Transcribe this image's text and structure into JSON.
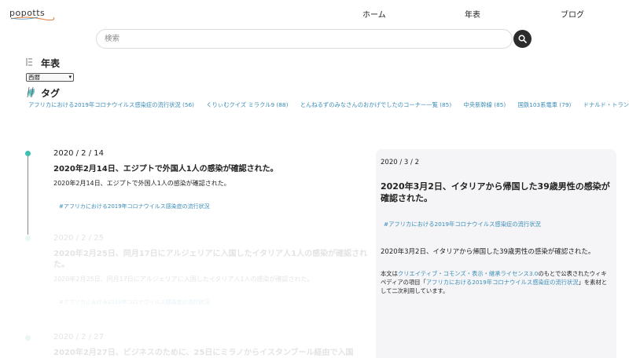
{
  "header": {
    "logo_text": "popotts",
    "nav": [
      {
        "label": "ホーム"
      },
      {
        "label": "年表"
      },
      {
        "label": "ブログ"
      }
    ]
  },
  "search": {
    "placeholder": "検索",
    "button_icon": "search-icon"
  },
  "nenpyo": {
    "title": "年表",
    "icon": "list-icon",
    "era_selected": "西暦"
  },
  "tags": {
    "title": "タグ",
    "icon": "tag-icon",
    "items": [
      {
        "label": "アフリカにおける2019年コロナウイルス感染症の流行状況 (56)"
      },
      {
        "label": "くりぃむクイズ ミラクル9 (88)"
      },
      {
        "label": "とんねるずのみなさんのおかげでしたのコーナー一覧 (85)"
      },
      {
        "label": "中央新幹線 (85)"
      },
      {
        "label": "国鉄103系電車 (79)"
      },
      {
        "label": "ドナルド・トラン"
      }
    ]
  },
  "timeline": [
    {
      "date": "2020 / 2 / 14",
      "title": "2020年2月14日、エジプトで外国人1人の感染が確認された。",
      "body": "2020年2月14日、エジプトで外国人1人の感染が確認された。",
      "tag": "#アフリカにおける2019年コロナウイルス感染症の流行状況"
    },
    {
      "date": "2020 / 2 / 25",
      "title": "2020年2月25日、同月17日にアルジェリアに入国したイタリア人1人の感染が確認された。",
      "body": "2020年2月25日、同月17日にアルジェリアに入国したイタリア人1人の感染が確認された。",
      "tag": "#アフリカにおける2019年コロナウイルス感染症の流行状況"
    },
    {
      "date": "2020 / 2 / 27",
      "title": "2020年2月27日、ビジネスのために、25日にミラノからイスタンブール経由で入国",
      "body": "",
      "tag": ""
    }
  ],
  "detail": {
    "date": "2020 / 3 / 2",
    "title": "2020年3月2日、イタリアから帰国した39歳男性の感染が確認された。",
    "tag": "#アフリカにおける2019年コロナウイルス感染症の流行状況",
    "body": "2020年3月2日、イタリアから帰国した39歳男性の感染が確認された。",
    "license_prefix": "本文は",
    "license_link": "クリエイティブ・コモンズ・表示・継承ライセンス3.0",
    "license_mid": "のもとで公表されたウィキペディアの項目「",
    "article_link": "アフリカにおける2019年コロナウイルス感染症の流行状況",
    "license_suffix": "」を素材として二次利用しています。"
  },
  "colors": {
    "accent": "#3fbfb0",
    "link": "#3b8cb8",
    "search_button": "#2b2b2b",
    "panel_bg": "#f5f5f7"
  }
}
